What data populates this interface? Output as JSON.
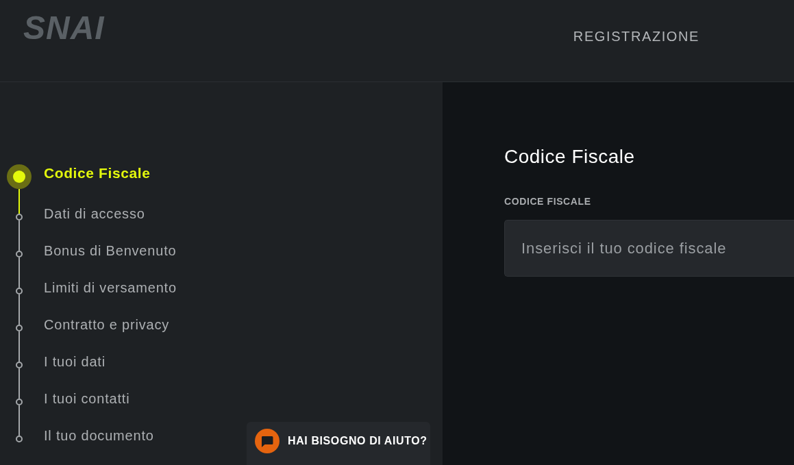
{
  "header": {
    "logo": "SNAI",
    "title": "REGISTRAZIONE"
  },
  "steps": [
    {
      "label": "Codice Fiscale",
      "selected": true
    },
    {
      "label": "Dati di accesso",
      "selected": false
    },
    {
      "label": "Bonus di Benvenuto",
      "selected": false
    },
    {
      "label": "Limiti di versamento",
      "selected": false
    },
    {
      "label": "Contratto e privacy",
      "selected": false
    },
    {
      "label": "I tuoi dati",
      "selected": false
    },
    {
      "label": "I tuoi contatti",
      "selected": false
    },
    {
      "label": "Il tuo documento",
      "selected": false
    }
  ],
  "form": {
    "title": "Codice Fiscale",
    "fields": [
      {
        "label": "CODICE FISCALE",
        "placeholder": "Inserisci il tuo codice fiscale"
      }
    ]
  },
  "help_button": {
    "label": "HAI BISOGNO DI AIUTO?"
  }
}
